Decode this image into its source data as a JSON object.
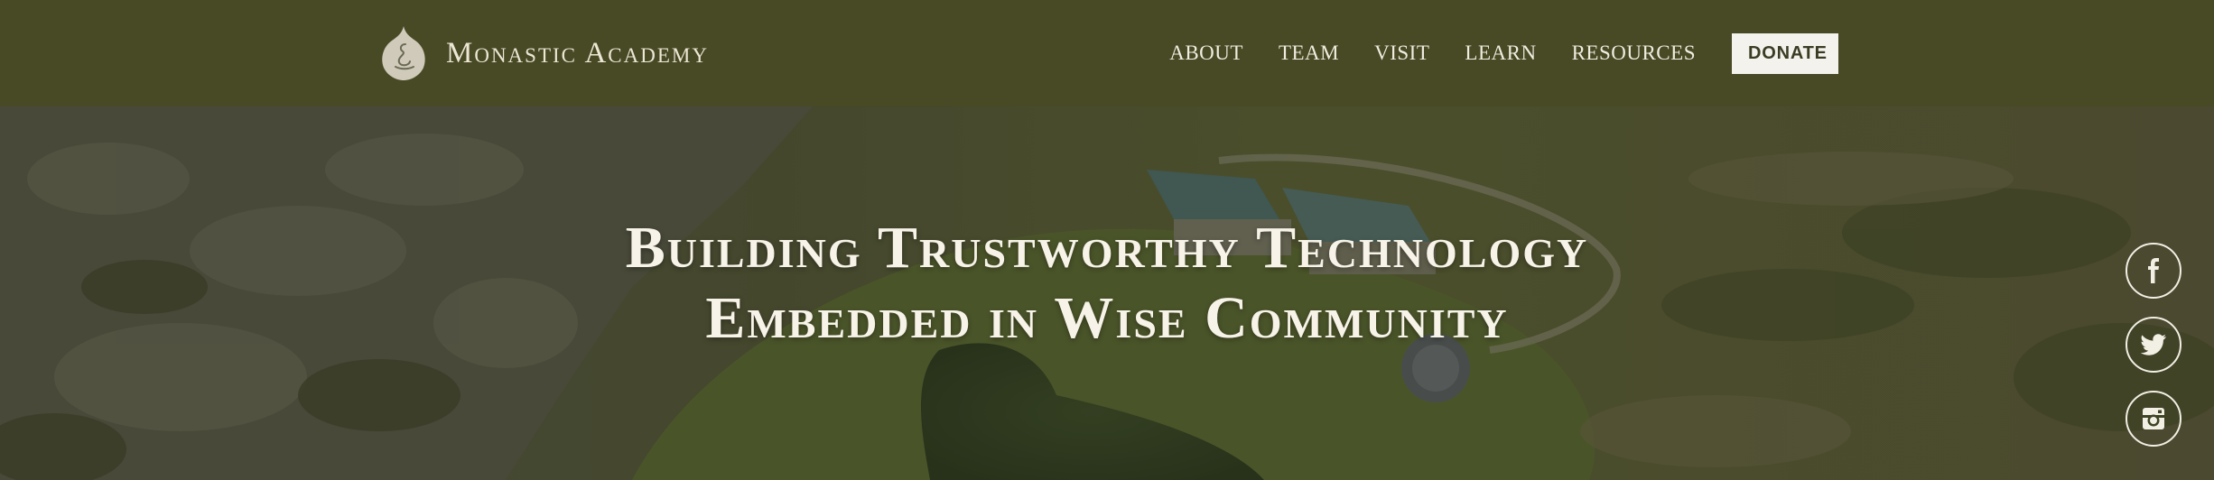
{
  "brand": {
    "name": "Monastic Academy",
    "logo_icon": "leaf-meditator-icon"
  },
  "nav": {
    "items": [
      {
        "label": "ABOUT"
      },
      {
        "label": "TEAM"
      },
      {
        "label": "VISIT"
      },
      {
        "label": "LEARN"
      },
      {
        "label": "RESOURCES"
      }
    ],
    "donate_label": "DONATE"
  },
  "hero": {
    "title_line1": "Building Trustworthy Technology",
    "title_line2": "Embedded in Wise Community"
  },
  "social": [
    {
      "icon": "facebook-icon"
    },
    {
      "icon": "twitter-icon"
    },
    {
      "icon": "instagram-icon"
    }
  ],
  "colors": {
    "header_bg": "#474a25",
    "donate_bg": "#f3f2ec",
    "text_light": "#f7f3e8"
  }
}
